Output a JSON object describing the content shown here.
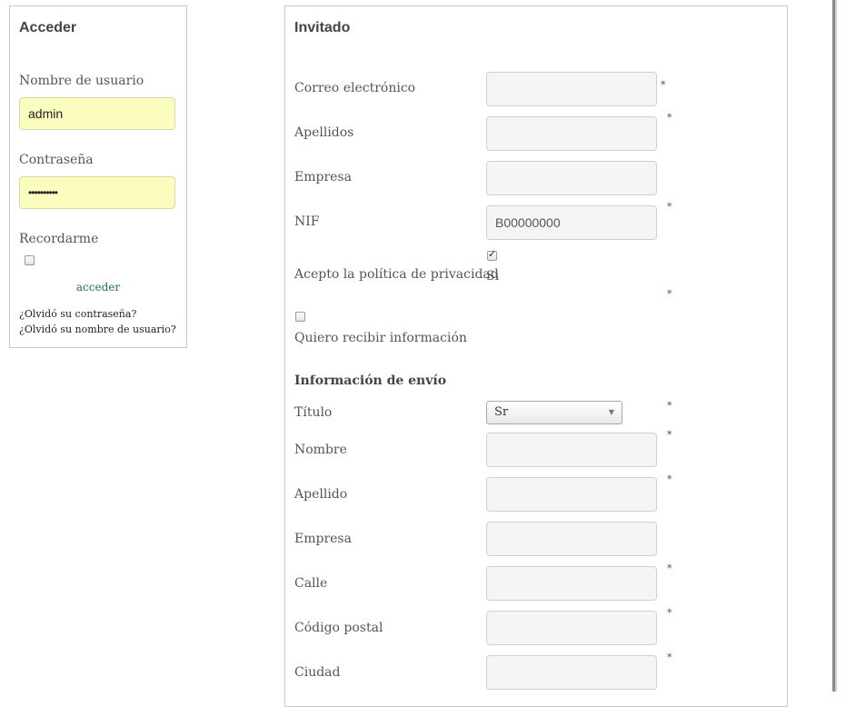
{
  "login": {
    "title": "Acceder",
    "username_label": "Nombre de usuario",
    "username_value": "admin",
    "password_label": "Contraseña",
    "password_value": "••••••••••",
    "remember_label": "Recordarme",
    "remember_checked": false,
    "submit_label": "acceder",
    "forgot_password": "¿Olvidó su contraseña?",
    "forgot_username": "¿Olvidó su nombre de usuario?"
  },
  "guest": {
    "title": "Invitado",
    "required_mark": "*",
    "fields": {
      "email": {
        "label": "Correo electrónico",
        "value": ""
      },
      "surname": {
        "label": "Apellidos",
        "value": ""
      },
      "company": {
        "label": "Empresa",
        "value": ""
      },
      "nif": {
        "label": "NIF",
        "value": "B00000000"
      }
    },
    "privacy": {
      "label": "Acepto la política de privacidad",
      "checkbox_text": "Si",
      "checked": true
    },
    "newsletter": {
      "label": "Quiero recibir información",
      "checked": false
    },
    "shipping": {
      "title": "Información de envío",
      "title_field": {
        "label": "Título",
        "value": "Sr"
      },
      "first_name": {
        "label": "Nombre",
        "value": ""
      },
      "last_name": {
        "label": "Apellido",
        "value": ""
      },
      "company": {
        "label": "Empresa",
        "value": ""
      },
      "street": {
        "label": "Calle",
        "value": ""
      },
      "postal_code": {
        "label": "Código postal",
        "value": ""
      },
      "city": {
        "label": "Ciudad",
        "value": ""
      }
    }
  },
  "icons": {
    "select_arrow": "chevron-down-icon",
    "checkbox_check": "checkmark-icon"
  },
  "colors": {
    "autofill_bg": "#fbfdbf",
    "input_bg": "#f5f5f5",
    "link_teal": "#1f6f6f",
    "border": "#c9c9c9"
  }
}
